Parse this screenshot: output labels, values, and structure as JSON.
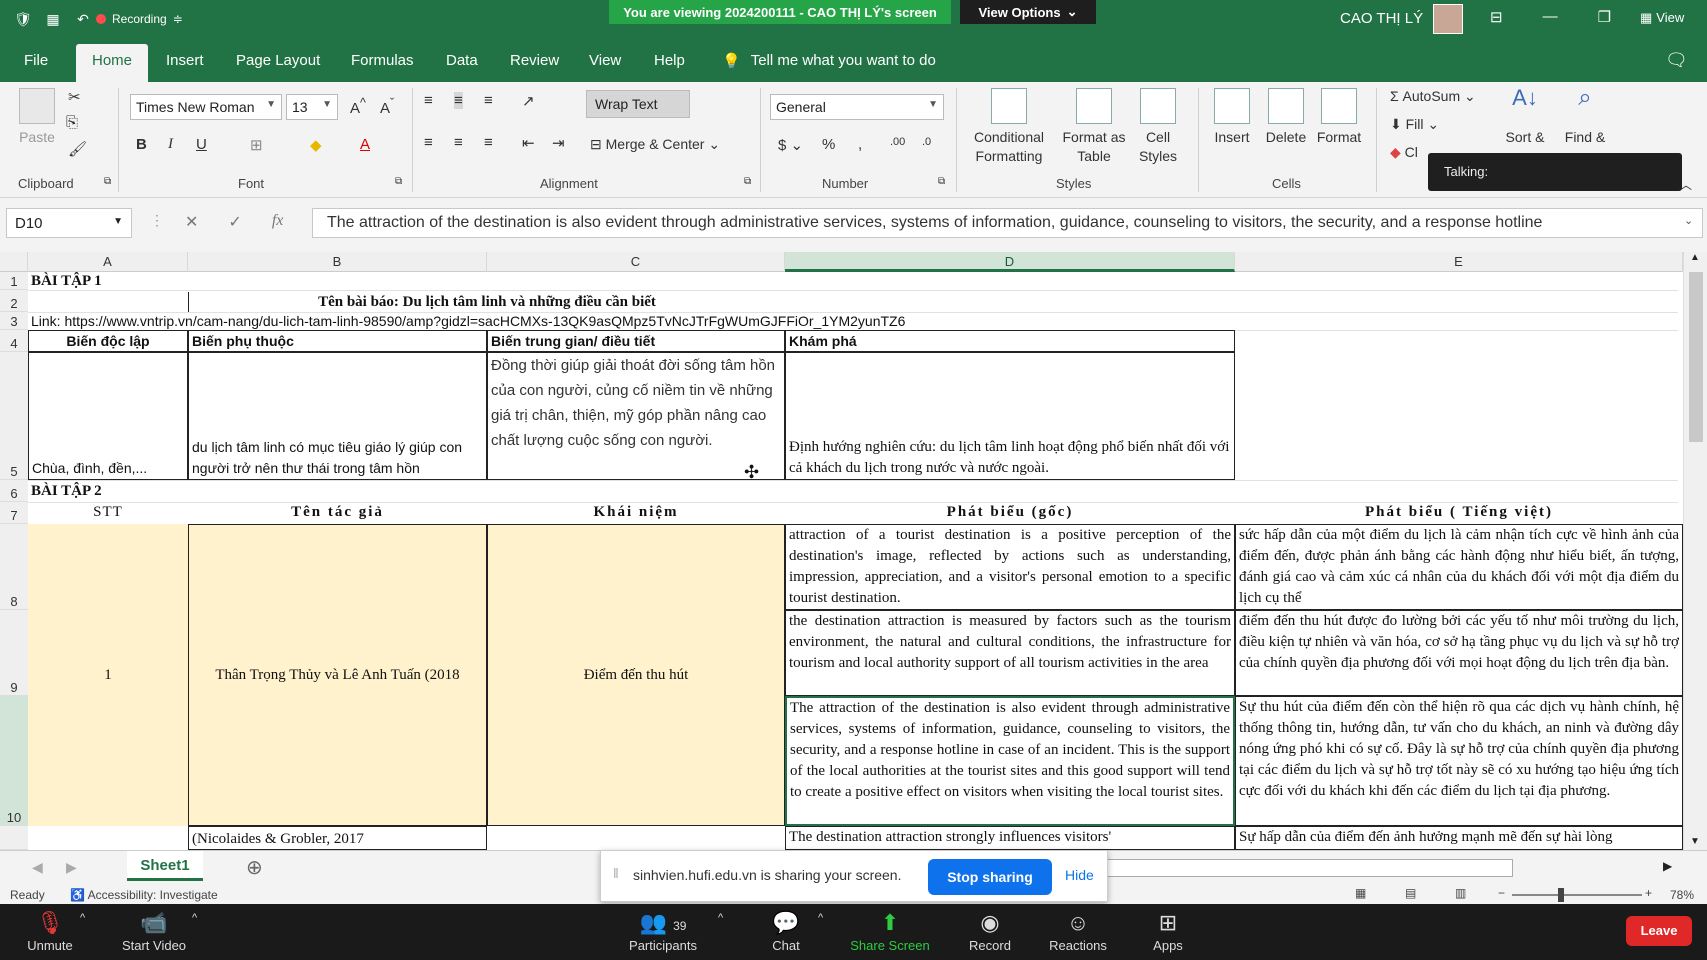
{
  "zoom_top": {
    "recording": "Recording",
    "viewing_banner": "You are viewing 2024200111 - CAO THỊ LÝ's screen",
    "view_options": "View Options",
    "view_label": "View"
  },
  "excel": {
    "user_name": "CAO THỊ LÝ",
    "menu_tabs": [
      "File",
      "Home",
      "Insert",
      "Page Layout",
      "Formulas",
      "Data",
      "Review",
      "View",
      "Help"
    ],
    "tell_me": "Tell me what you want to do",
    "ribbon": {
      "clipboard": {
        "paste": "Paste",
        "label": "Clipboard"
      },
      "font": {
        "name": "Times New Roman",
        "size": "13",
        "label": "Font"
      },
      "alignment": {
        "wrap_text": "Wrap Text",
        "merge_center": "Merge & Center",
        "label": "Alignment"
      },
      "number": {
        "format": "General",
        "label": "Number"
      },
      "styles": {
        "conditional_1": "Conditional",
        "conditional_2": "Formatting",
        "format_table_1": "Format as",
        "format_table_2": "Table",
        "cell_styles_1": "Cell",
        "cell_styles_2": "Styles",
        "label": "Styles"
      },
      "cells": {
        "insert": "Insert",
        "delete": "Delete",
        "format": "Format",
        "label": "Cells"
      },
      "editing": {
        "autosum": "AutoSum",
        "fill": "Fill",
        "clear": "Cl",
        "sort": "Sort &",
        "find": "Find &"
      }
    },
    "talking": "Talking:",
    "name_box": "D10",
    "formula": "The attraction of the destination is also evident through administrative services, systems of information, guidance, counseling to visitors, the security, and a response hotline",
    "columns": [
      "A",
      "B",
      "C",
      "D",
      "E"
    ],
    "rows": [
      "1",
      "2",
      "3",
      "4",
      "5",
      "6",
      "7",
      "8",
      "9",
      "10"
    ],
    "cells": {
      "A1": "BÀI TẬP 1",
      "B2": "Tên bài báo: Du lịch tâm linh và những điều cần biết",
      "A3": "Link: https://www.vntrip.vn/cam-nang/du-lich-tam-linh-98590/amp?gidzl=sacHCMXs-13QK9asQMpz5TvNcJTrFgWUmGJFFiOr_1YM2yunTZ6",
      "A4": "Biến độc lập",
      "B4": "Biến phụ thuộc",
      "C4": "Biến trung gian/ điều tiết",
      "D4": "Khám phá",
      "A5": "Chùa, đình, đền,...",
      "B5": "du lịch tâm linh có mục tiêu giáo lý giúp con người trở nên thư thái trong tâm hồn",
      "C5": "Đồng thời giúp giải thoát đời sống tâm hồn của con người, củng cố niềm tin về những giá trị chân, thiện, mỹ góp phần nâng cao chất lượng cuộc sống con người.",
      "D5": "Định hướng nghiên cứu: du lịch tâm linh hoạt động phổ biến nhất đối với cả khách du lịch trong nước và nước ngoài.",
      "A6": "BÀI TẬP 2",
      "A7": "STT",
      "B7": "Tên tác giả",
      "C7": "Khái niệm",
      "D7": "Phát biểu (gốc)",
      "E7": "Phát biểu ( Tiếng việt)",
      "A8": "1",
      "B8": "Thân Trọng Thủy và Lê Anh Tuấn (2018",
      "C8": "Điểm đến thu hút",
      "D8": " attraction of a tourist destination is a positive perception of the destination's image, reflected by actions such as understanding, impression, appreciation, and a visitor's personal emotion to a specific tourist destination.",
      "E8": " sức hấp dẫn của một điểm du lịch là cảm nhận tích cực về hình ảnh của điểm đến, được phản ánh bằng các hành động như hiểu biết, ấn tượng, đánh giá cao và cảm xúc cá nhân của du khách đối với một địa điểm du lịch cụ thể",
      "D9": "the destination attraction is measured by factors such as the tourism environment, the natural and cultural conditions, the infrastructure for tourism and local authority support of all tourism activities in the area",
      "E9": "điểm đến thu hút được đo lường bởi các yếu tố như môi trường du lịch, điều kiện tự nhiên và văn hóa, cơ sở hạ tầng phục vụ du lịch và sự hỗ trợ của chính quyền địa phương đối với mọi hoạt động du lịch trên địa bàn.",
      "D10": "The attraction of the destination is also evident through administrative services, systems of information, guidance, counseling to visitors, the security, and a response hotline in case of an incident. This is the support of the local authorities at the tourist sites and this good support will tend to create a positive effect on visitors when visiting the local tourist sites.",
      "E10": "Sự thu hút của điểm đến còn thể hiện rõ qua các dịch vụ hành chính, hệ thống thông tin, hướng dẫn, tư vấn cho du khách, an ninh và đường dây nóng ứng phó khi có sự cố. Đây là sự hỗ trợ của chính quyền địa phương tại các điểm du lịch và sự hỗ trợ tốt này sẽ có xu hướng tạo hiệu ứng tích cực đối với du khách khi đến các điểm du lịch tại địa phương.",
      "B11": "(Nicolaides & Grobler, 2017",
      "D11": "The destination attraction strongly influences visitors'",
      "E11": "Sự hấp dẫn của điểm đến ảnh hưởng mạnh mẽ đến sự hài lòng"
    },
    "sheet_tab": "Sheet1",
    "status": {
      "ready": "Ready",
      "accessibility": "Accessibility: Investigate",
      "zoom": "78%"
    }
  },
  "share_popup": {
    "text": "sinhvien.hufi.edu.vn is sharing your screen.",
    "stop": "Stop sharing",
    "hide": "Hide"
  },
  "zoom_toolbar": {
    "unmute": "Unmute",
    "start_video": "Start Video",
    "participants": "Participants",
    "participants_count": "39",
    "chat": "Chat",
    "share_screen": "Share Screen",
    "record": "Record",
    "reactions": "Reactions",
    "apps": "Apps",
    "leave": "Leave"
  },
  "colors": {
    "excel_green": "#217346",
    "zoom_blue": "#0e72ed",
    "banner_green": "#26a448",
    "leave_red": "#e02828",
    "cell_yellow": "#fff2cc"
  }
}
